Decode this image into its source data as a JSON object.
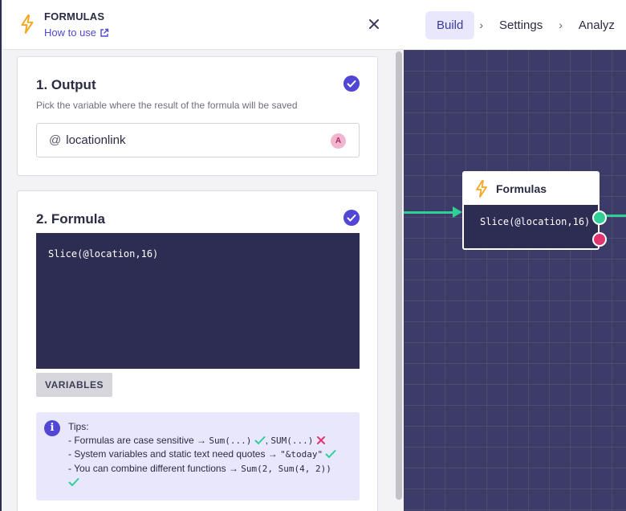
{
  "panel": {
    "title": "FORMULAS",
    "how_to_use": "How to use",
    "icons": {
      "header": "lightning-bolt-icon",
      "external": "external-link-icon",
      "close": "close-icon"
    }
  },
  "output": {
    "title": "1. Output",
    "subtitle": "Pick the variable where the result of the formula will be saved",
    "variable_prefix": "@",
    "variable": "locationlink",
    "avatar_letter": "A"
  },
  "formula": {
    "title": "2. Formula",
    "code": "Slice(@location,16)",
    "variables_button": "VARIABLES",
    "tips": {
      "heading": "Tips:",
      "line1_text": "- Formulas are case sensitive → ",
      "line1_good": "Sum(...)",
      "line1_sep": ", ",
      "line1_bad": "SUM(...)",
      "line2_text": "- System variables and static text need quotes → ",
      "line2_code": "\"&today\"",
      "line3_text": "- You can combine different functions → ",
      "line3_code": "Sum(2, Sum(4, 2))"
    }
  },
  "topbar": {
    "tabs": [
      "Build",
      "Settings",
      "Analyz"
    ],
    "active_tab": "Build",
    "separator": "›"
  },
  "node": {
    "title": "Formulas",
    "body": "Slice(@location,16)"
  },
  "colors": {
    "accent": "#5147d4",
    "canvas": "#3d3c68",
    "editor": "#2d2c52",
    "success": "#2fcf96",
    "error": "#e2346e",
    "bolt": "#f5a623"
  }
}
